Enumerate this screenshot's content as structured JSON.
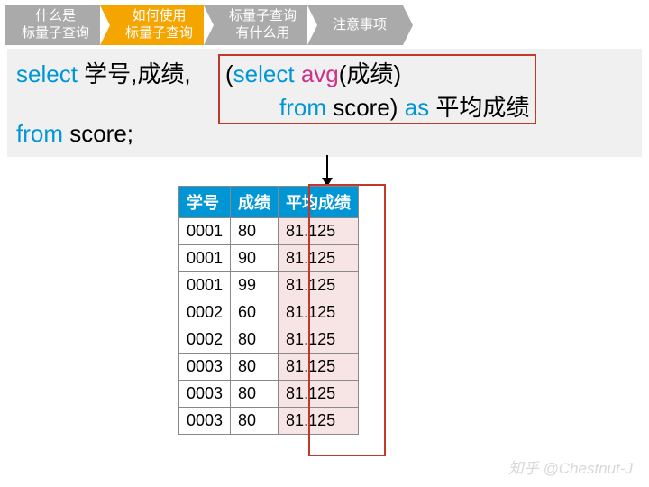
{
  "nav": {
    "items": [
      {
        "l1": "什么是",
        "l2": "标量子查询"
      },
      {
        "l1": "如何使用",
        "l2": "标量子查询"
      },
      {
        "l1": "标量子查询",
        "l2": "有什么用"
      },
      {
        "l1": "注意事项",
        "l2": ""
      }
    ]
  },
  "sql": {
    "select": "select",
    "cols": " 学号,成绩,",
    "sub_open": "(",
    "sub_select": "select ",
    "avg": "avg",
    "avg_arg": "(成绩)",
    "from": "from",
    "sub_table": " score) ",
    "as": "as",
    "alias": " 平均成绩",
    "main_table": " score;"
  },
  "table": {
    "headers": [
      "学号",
      "成绩",
      "平均成绩"
    ],
    "rows": [
      {
        "id": "0001",
        "score": "80",
        "avg": "81.125"
      },
      {
        "id": "0001",
        "score": "90",
        "avg": "81.125"
      },
      {
        "id": "0001",
        "score": "99",
        "avg": "81.125"
      },
      {
        "id": "0002",
        "score": "60",
        "avg": "81.125"
      },
      {
        "id": "0002",
        "score": "80",
        "avg": "81.125"
      },
      {
        "id": "0003",
        "score": "80",
        "avg": "81.125"
      },
      {
        "id": "0003",
        "score": "80",
        "avg": "81.125"
      },
      {
        "id": "0003",
        "score": "80",
        "avg": "81.125"
      }
    ]
  },
  "watermark": "知乎 @Chestnut-J"
}
